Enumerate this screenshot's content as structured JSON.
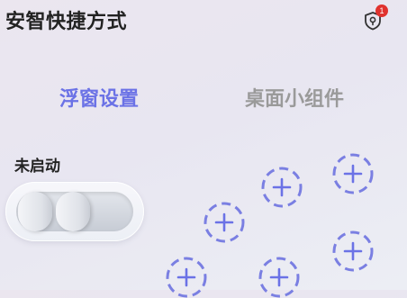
{
  "header": {
    "title": "安智快捷方式",
    "security_badge_count": "1"
  },
  "tabs": [
    {
      "label": "浮窗设置",
      "active": true
    },
    {
      "label": "桌面小组件",
      "active": false
    }
  ],
  "status": {
    "label": "未启动",
    "enabled": false
  },
  "add_slots": [
    {
      "icon": "plus-dashed-circle-icon"
    },
    {
      "icon": "plus-dashed-circle-icon"
    },
    {
      "icon": "plus-dashed-circle-icon"
    },
    {
      "icon": "plus-dashed-circle-icon"
    },
    {
      "icon": "plus-dashed-circle-icon"
    },
    {
      "icon": "plus-dashed-circle-icon"
    }
  ],
  "colors": {
    "accent": "#6b72e6",
    "inactive_tab": "#9a9a9a",
    "badge": "#e0322e",
    "dashed_circle": "#7a7fe2"
  }
}
